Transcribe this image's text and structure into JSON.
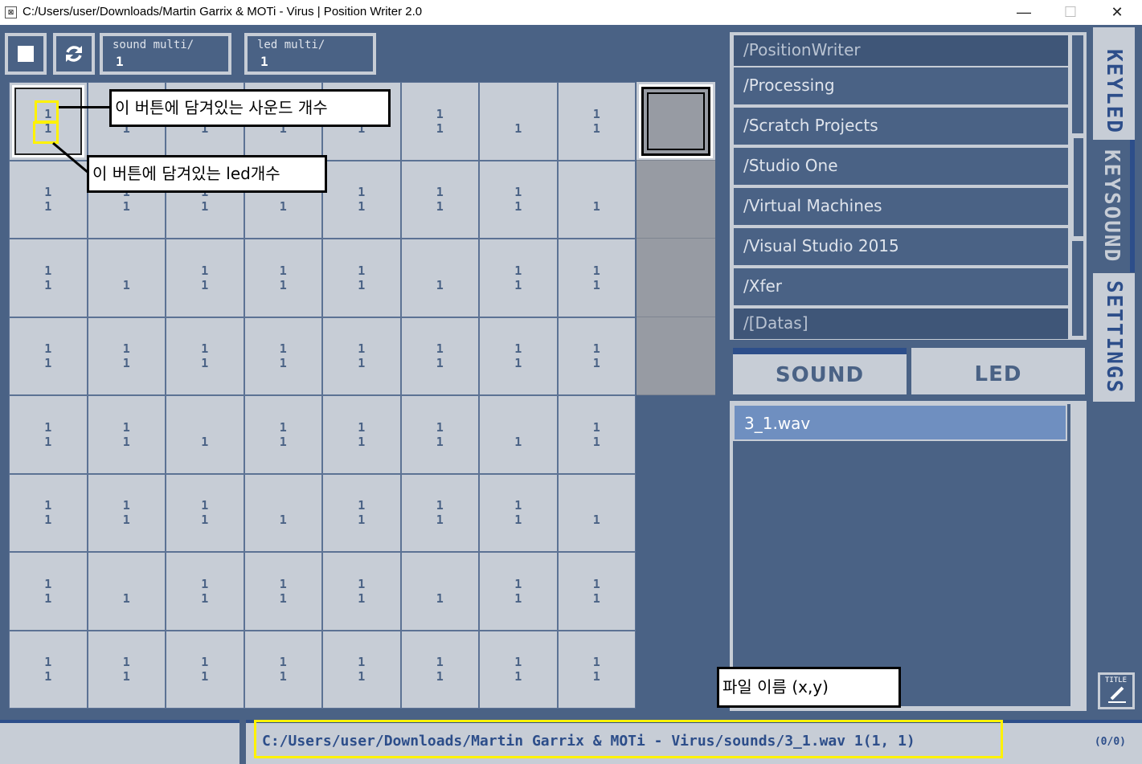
{
  "window": {
    "title": "C:/Users/user/Downloads/Martin Garrix & MOTi - Virus | Position Writer 2.0",
    "minimize": "—",
    "maximize": "☐",
    "close": "✕"
  },
  "toolbar": {
    "sound_multi_label": "sound multi/",
    "sound_multi_value": "1",
    "led_multi_label": "led multi/",
    "led_multi_value": "1"
  },
  "grid": [
    [
      [
        "1",
        "1"
      ],
      [
        "1",
        "1"
      ],
      [
        "1",
        "1"
      ],
      [
        "1",
        "1"
      ],
      [
        "1",
        "1"
      ],
      [
        "1",
        "1"
      ],
      [
        "",
        "1"
      ],
      [
        "1",
        "1"
      ]
    ],
    [
      [
        "1",
        "1"
      ],
      [
        "1",
        "1"
      ],
      [
        "1",
        "1"
      ],
      [
        "",
        "1"
      ],
      [
        "1",
        "1"
      ],
      [
        "1",
        "1"
      ],
      [
        "1",
        "1"
      ],
      [
        "",
        "1"
      ]
    ],
    [
      [
        "1",
        "1"
      ],
      [
        "",
        "1"
      ],
      [
        "1",
        "1"
      ],
      [
        "1",
        "1"
      ],
      [
        "1",
        "1"
      ],
      [
        "",
        "1"
      ],
      [
        "1",
        "1"
      ],
      [
        "1",
        "1"
      ]
    ],
    [
      [
        "1",
        "1"
      ],
      [
        "1",
        "1"
      ],
      [
        "1",
        "1"
      ],
      [
        "1",
        "1"
      ],
      [
        "1",
        "1"
      ],
      [
        "1",
        "1"
      ],
      [
        "1",
        "1"
      ],
      [
        "1",
        "1"
      ]
    ],
    [
      [
        "1",
        "1"
      ],
      [
        "1",
        "1"
      ],
      [
        "",
        "1"
      ],
      [
        "1",
        "1"
      ],
      [
        "1",
        "1"
      ],
      [
        "1",
        "1"
      ],
      [
        "",
        "1"
      ],
      [
        "1",
        "1"
      ]
    ],
    [
      [
        "1",
        "1"
      ],
      [
        "1",
        "1"
      ],
      [
        "1",
        "1"
      ],
      [
        "",
        "1"
      ],
      [
        "1",
        "1"
      ],
      [
        "1",
        "1"
      ],
      [
        "1",
        "1"
      ],
      [
        "",
        "1"
      ]
    ],
    [
      [
        "1",
        "1"
      ],
      [
        "",
        "1"
      ],
      [
        "1",
        "1"
      ],
      [
        "1",
        "1"
      ],
      [
        "1",
        "1"
      ],
      [
        "",
        "1"
      ],
      [
        "1",
        "1"
      ],
      [
        "1",
        "1"
      ]
    ],
    [
      [
        "1",
        "1"
      ],
      [
        "1",
        "1"
      ],
      [
        "1",
        "1"
      ],
      [
        "1",
        "1"
      ],
      [
        "1",
        "1"
      ],
      [
        "1",
        "1"
      ],
      [
        "1",
        "1"
      ],
      [
        "1",
        "1"
      ]
    ]
  ],
  "file_browser": {
    "items": [
      "/PositionWriter",
      "/Processing",
      "/Scratch Projects",
      "/Studio One",
      "/Virtual Machines",
      "/Visual Studio 2015",
      "/Xfer",
      "/[Datas]"
    ]
  },
  "tabs": {
    "sound": "SOUND",
    "led": "LED"
  },
  "sound_list": {
    "items": [
      "3_1.wav"
    ]
  },
  "side_tabs": {
    "keyled": "KEYLED",
    "keysound": "KEYSOUND",
    "settings": "SETTINGS"
  },
  "edit_button_label": "TITLE",
  "status": {
    "path": "C:/Users/user/Downloads/Martin Garrix & MOTi - Virus/sounds/3_1.wav 1(1, 1)",
    "counter": "(0/0)"
  },
  "annotations": {
    "sound_count": "이 버튼에 담겨있는 사운드 개수",
    "led_count": "이 버튼에 담겨있는 led개수",
    "file_name": "파일 이름 (x,y)"
  },
  "colors": {
    "background": "#4a6285",
    "panel": "#c7cdd6",
    "accent": "#2d4e8a",
    "highlight": "#6f8fc0",
    "annotation_box": "#fff200"
  }
}
